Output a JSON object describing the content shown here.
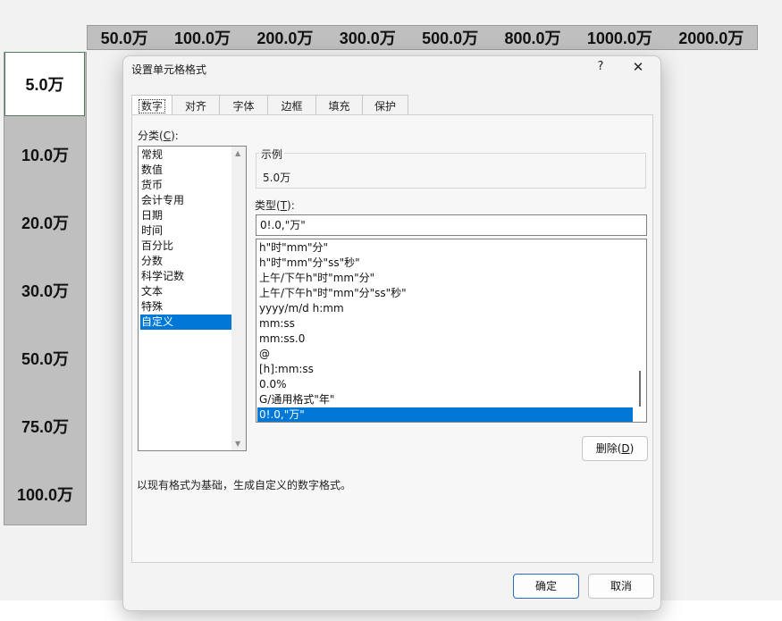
{
  "sheet": {
    "col_headers": [
      "50.0万",
      "100.0万",
      "200.0万",
      "300.0万",
      "500.0万",
      "800.0万",
      "1000.0万",
      "2000.0万"
    ],
    "row_selected": "5.0万",
    "row_labels": [
      "10.0万",
      "20.0万",
      "30.0万",
      "50.0万",
      "75.0万",
      "100.0万"
    ]
  },
  "dialog": {
    "title": "设置单元格格式",
    "help": "?",
    "close": "✕",
    "tabs": [
      "数字",
      "对齐",
      "字体",
      "边框",
      "填充",
      "保护"
    ],
    "category_label": "分类(C):",
    "category_label_main": "分类(",
    "category_label_key": "C",
    "category_label_tail": "):",
    "categories": [
      "常规",
      "数值",
      "货币",
      "会计专用",
      "日期",
      "时间",
      "百分比",
      "分数",
      "科学记数",
      "文本",
      "特殊",
      "自定义"
    ],
    "selected_category": "自定义",
    "sample_label": "示例",
    "sample_value": "5.0万",
    "type_label_main": "类型(",
    "type_label_key": "T",
    "type_label_tail": "):",
    "type_input": "0!.0,\"万\"",
    "formats": [
      "h\"时\"mm\"分\"",
      "h\"时\"mm\"分\"ss\"秒\"",
      "上午/下午h\"时\"mm\"分\"",
      "上午/下午h\"时\"mm\"分\"ss\"秒\"",
      "yyyy/m/d h:mm",
      "mm:ss",
      "mm:ss.0",
      "@",
      "[h]:mm:ss",
      "0.0%",
      "G/通用格式\"年\"",
      "0!.0,\"万\""
    ],
    "selected_format": "0!.0,\"万\"",
    "delete_main": "删除(",
    "delete_key": "D",
    "delete_tail": ")",
    "description": "以现有格式为基础，生成自定义的数字格式。",
    "ok": "确定",
    "cancel": "取消"
  },
  "colors": {
    "selection": "#0078d7",
    "sheet_header": "#bfbfbf"
  }
}
